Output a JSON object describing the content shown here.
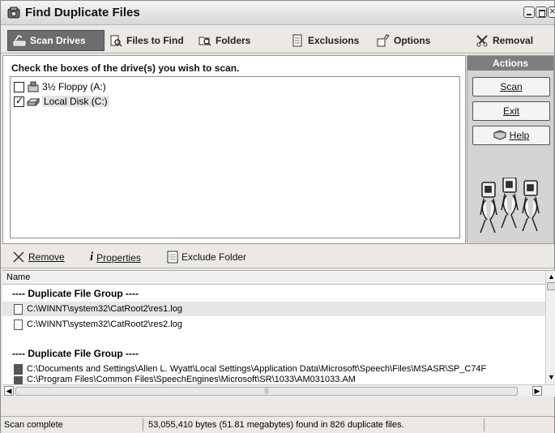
{
  "window": {
    "title": "Find Duplicate Files"
  },
  "tabs": [
    {
      "label": "Scan Drives",
      "icon": "scan-drives-icon",
      "active": true
    },
    {
      "label": "Files to Find",
      "icon": "files-icon"
    },
    {
      "label": "Folders",
      "icon": "folders-icon"
    },
    {
      "label": "Exclusions",
      "icon": "exclusions-icon"
    },
    {
      "label": "Options",
      "icon": "options-icon"
    },
    {
      "label": "Removal",
      "icon": "removal-icon"
    }
  ],
  "drives": {
    "instruction": "Check the boxes of the drive(s) you wish to scan.",
    "items": [
      {
        "label": "3½ Floppy (A:)",
        "checked": false
      },
      {
        "label": "Local Disk (C:)",
        "checked": true
      }
    ]
  },
  "actions": {
    "header": "Actions",
    "scan": "Scan",
    "exit": "Exit",
    "help": "Help"
  },
  "toolbar": {
    "remove": "Remove",
    "properties": "Properties",
    "exclude_folder": "Exclude Folder"
  },
  "results": {
    "column_name": "Name",
    "group_label": "---- Duplicate File Group ----",
    "files": [
      "C:\\WINNT\\system32\\CatRoot2\\res1.log",
      "C:\\WINNT\\system32\\CatRoot2\\res2.log",
      "C:\\Documents and Settings\\Allen L. Wyatt\\Local Settings\\Application Data\\Microsoft\\Speech\\Files\\MSASR\\SP_C74F",
      "C:\\Program Files\\Common Files\\SpeechEngines\\Microsoft\\SR\\1033\\AM031033.AM"
    ]
  },
  "status": {
    "left": "Scan complete",
    "right": "53,055,410 bytes (51.81 megabytes) found in 826 duplicate files."
  }
}
